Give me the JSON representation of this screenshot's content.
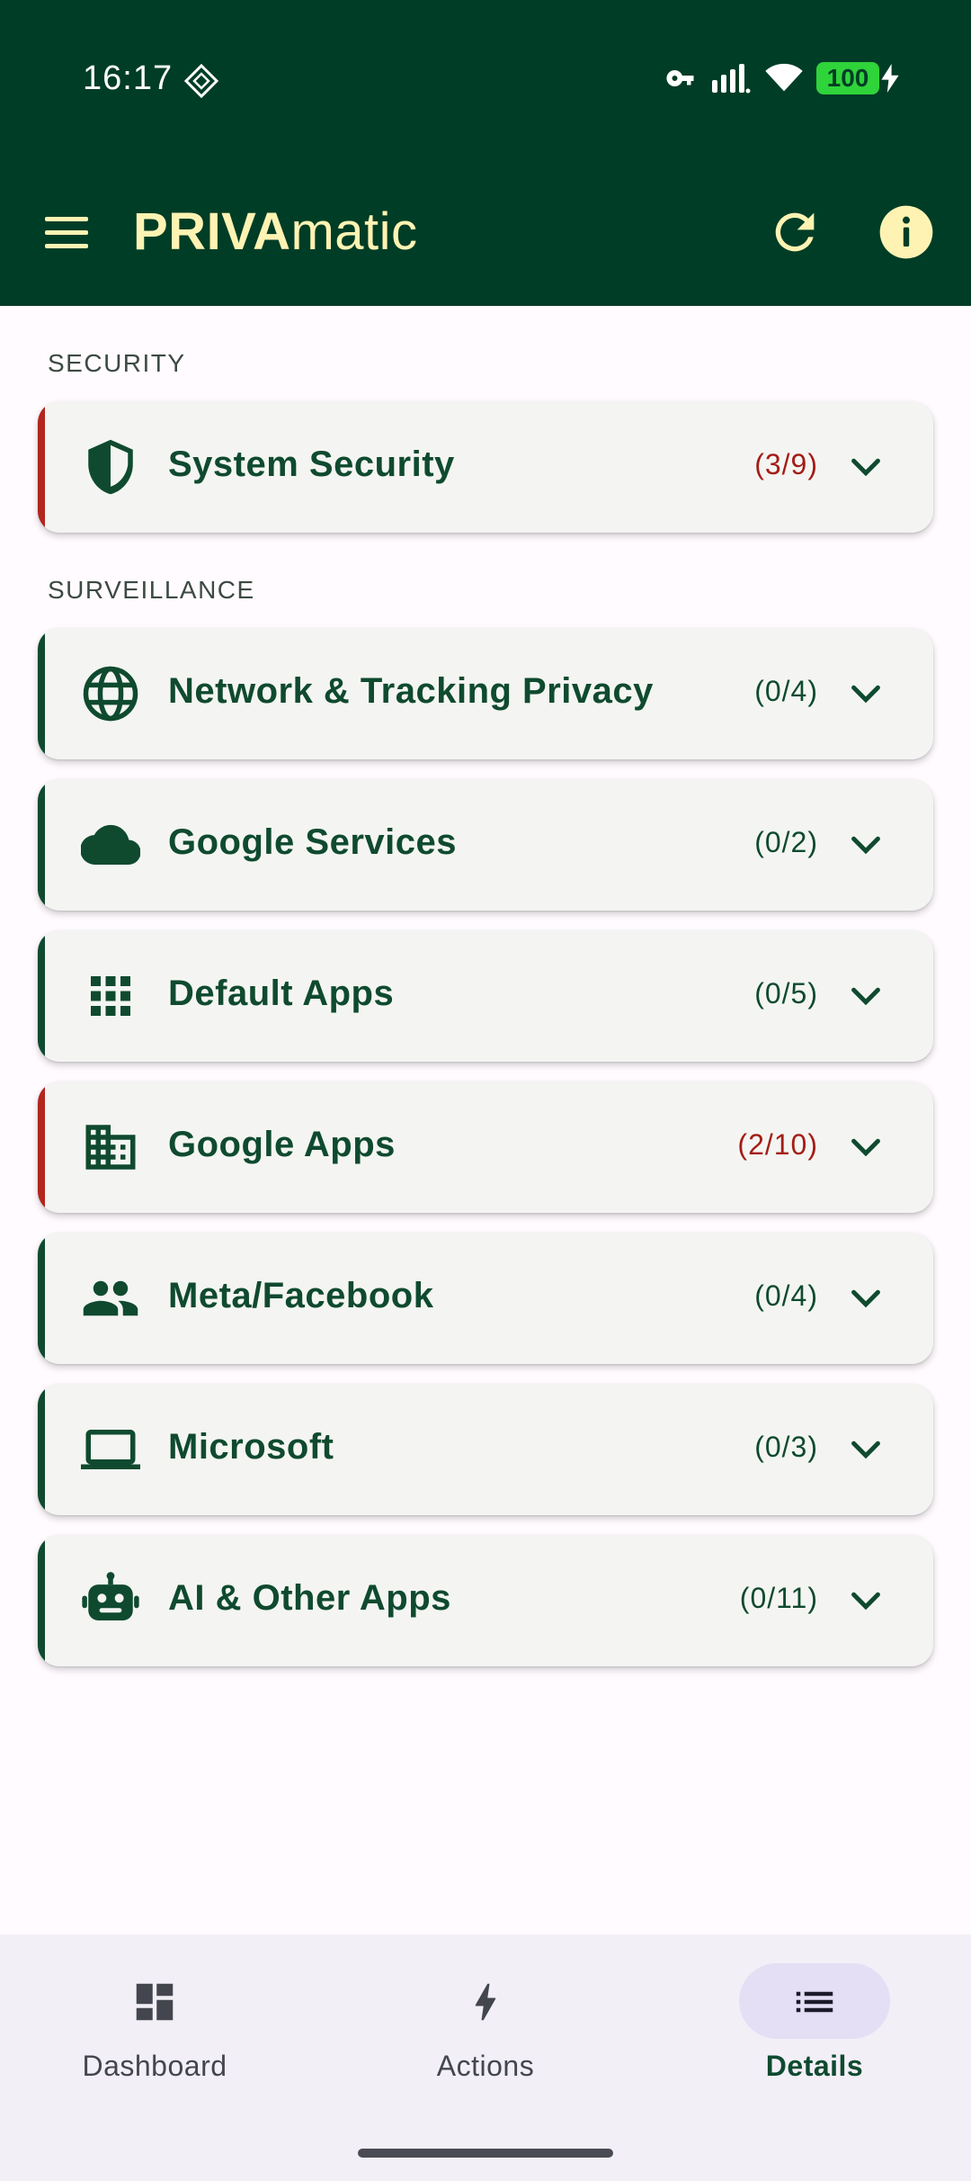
{
  "status": {
    "time": "16:17",
    "battery": "100"
  },
  "app": {
    "title_bold": "PRIVA",
    "title_rest": "matic"
  },
  "sections": [
    {
      "label": "SECURITY"
    },
    {
      "label": "SURVEILLANCE"
    }
  ],
  "cards": [
    {
      "label": "System Security",
      "count": "(3/9)",
      "icon": "shield-icon",
      "status": "warn"
    },
    {
      "label": "Network & Tracking Privacy",
      "count": "(0/4)",
      "icon": "globe-icon",
      "status": "ok"
    },
    {
      "label": "Google Services",
      "count": "(0/2)",
      "icon": "cloud-icon",
      "status": "ok"
    },
    {
      "label": "Default Apps",
      "count": "(0/5)",
      "icon": "apps-grid-icon",
      "status": "ok"
    },
    {
      "label": "Google Apps",
      "count": "(2/10)",
      "icon": "building-icon",
      "status": "warn"
    },
    {
      "label": "Meta/Facebook",
      "count": "(0/4)",
      "icon": "people-icon",
      "status": "ok"
    },
    {
      "label": "Microsoft",
      "count": "(0/3)",
      "icon": "laptop-icon",
      "status": "ok"
    },
    {
      "label": "AI & Other Apps",
      "count": "(0/11)",
      "icon": "robot-icon",
      "status": "ok"
    }
  ],
  "nav": [
    {
      "label": "Dashboard",
      "icon": "dashboard-icon",
      "active": false
    },
    {
      "label": "Actions",
      "icon": "bolt-icon",
      "active": false
    },
    {
      "label": "Details",
      "icon": "list-icon",
      "active": true
    }
  ],
  "colors": {
    "primary": "#003d26",
    "accent_ok": "#0f4a2f",
    "accent_warn": "#b3261e",
    "title_yellow": "#fff3b3",
    "nav_pill": "#e4dff5"
  }
}
